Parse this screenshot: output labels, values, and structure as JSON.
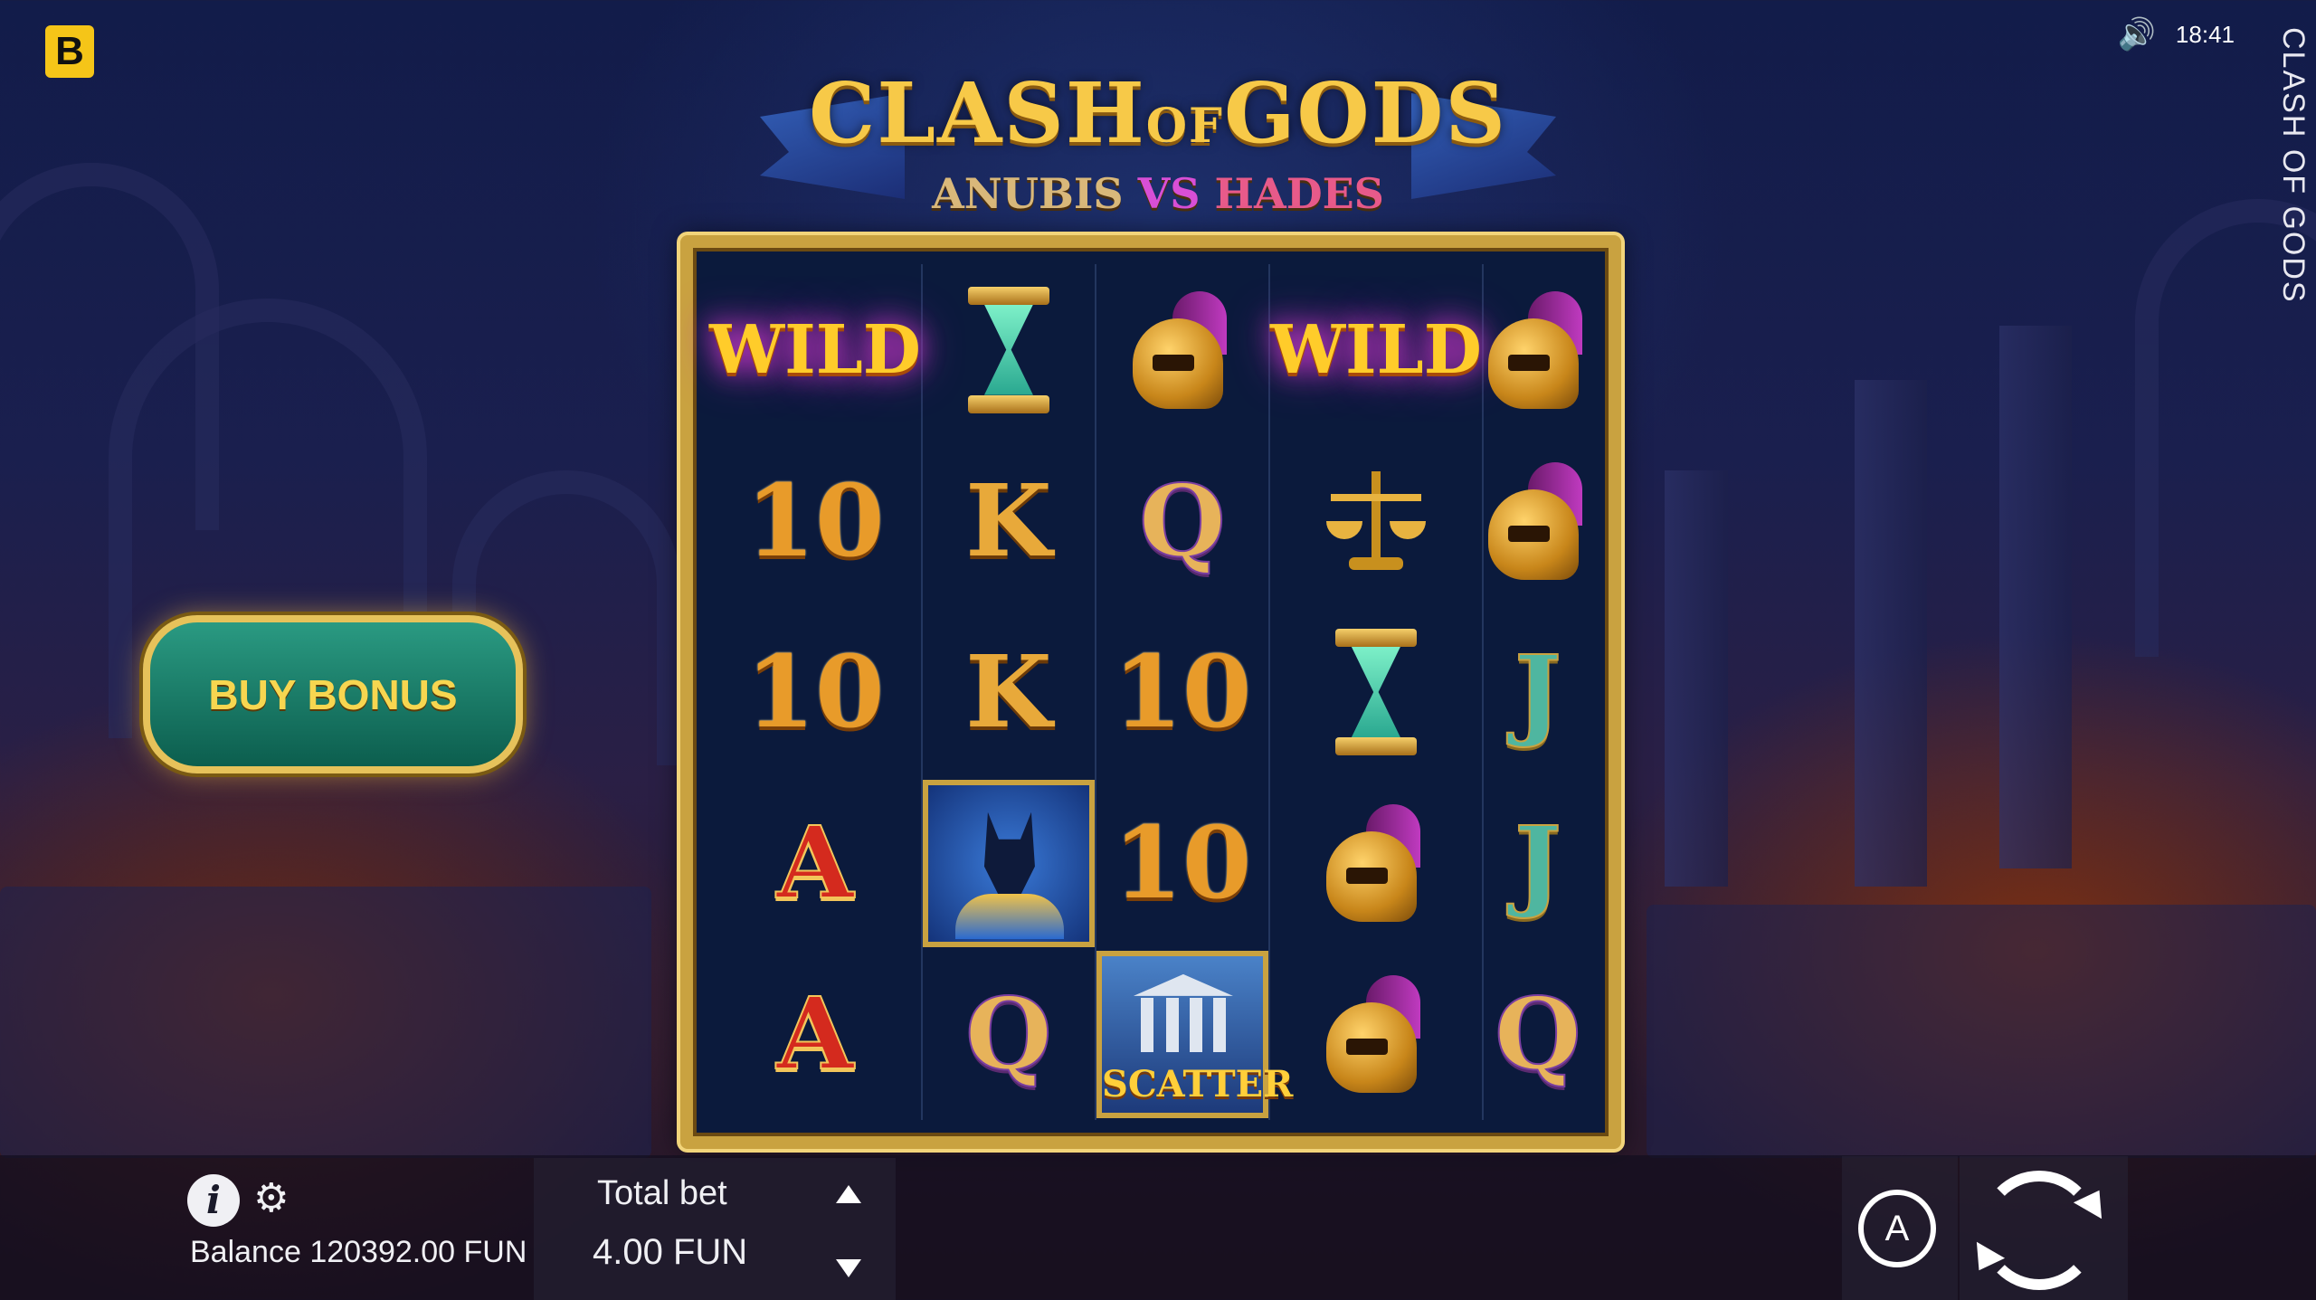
{
  "brand": {
    "logo_letter": "B"
  },
  "status": {
    "sound_icon": "speaker-icon",
    "time": "18:41"
  },
  "side_title": "CLASH OF GODS",
  "game_title": {
    "main_left": "CLASH",
    "main_of": "OF",
    "main_right": "GODS",
    "sub_left": "ANUBIS",
    "sub_vs": "VS",
    "sub_right": "HADES"
  },
  "buy_bonus": {
    "label": "BUY BONUS"
  },
  "reels": [
    [
      "WILD",
      "hourglass",
      "helmet",
      "WILD",
      "helmet"
    ],
    [
      "10",
      "K",
      "Q",
      "scales",
      "helmet"
    ],
    [
      "10",
      "K",
      "10",
      "hourglass",
      "J"
    ],
    [
      "A",
      "anubis",
      "10",
      "helmet",
      "J"
    ],
    [
      "A",
      "Q",
      "SCATTER",
      "helmet",
      "Q"
    ]
  ],
  "symbols": {
    "wild": "WILD",
    "scatter": "SCATTER",
    "ten": "10",
    "king": "K",
    "queen": "Q",
    "jack": "J",
    "ace": "A"
  },
  "bottom_bar": {
    "balance_label": "Balance",
    "balance_value": "120392.00",
    "balance_currency": "FUN",
    "total_bet_label": "Total bet",
    "total_bet_value": "4.00",
    "total_bet_currency": "FUN",
    "info_glyph": "i",
    "autoplay_glyph": "A"
  }
}
